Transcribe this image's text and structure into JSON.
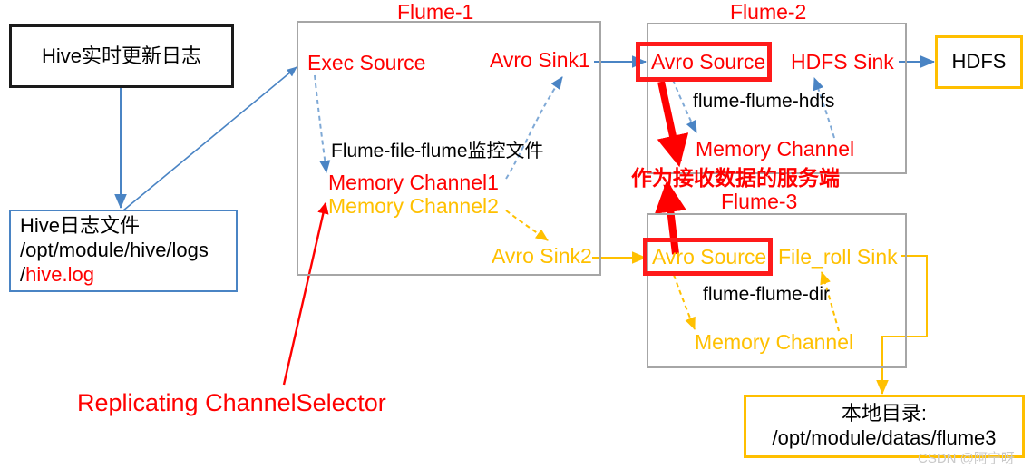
{
  "diagram": {
    "title": "Flume multi-agent replicating channel selector topology",
    "colors": {
      "red": "#ff0000",
      "yellow": "#ffc000",
      "blue": "#4a84c4",
      "black": "#000000",
      "frame_gray": "#a6a6a6"
    }
  },
  "source_box": {
    "label": "Hive实时更新日志"
  },
  "logfile_box": {
    "line1": "Hive日志文件",
    "line2": "/opt/module/hive/logs",
    "line3_prefix": "/",
    "line3_file": "hive.log"
  },
  "flume1": {
    "title": "Flume-1",
    "config_name": "Flume-file-flume监控文件",
    "source": "Exec Source",
    "sink1": "Avro Sink1",
    "sink2": "Avro Sink2",
    "channel1": "Memory  Channel1",
    "channel2": "Memory  Channel2"
  },
  "flume2": {
    "title": "Flume-2",
    "config_name": "flume-flume-hdfs",
    "source": "Avro Source",
    "sink": "HDFS Sink",
    "channel": "Memory Channel"
  },
  "flume3": {
    "title": "Flume-3",
    "config_name": "flume-flume-dir",
    "source": "Avro Source",
    "sink": "File_roll Sink",
    "channel": "Memory Channel"
  },
  "hdfs_box": {
    "label": "HDFS"
  },
  "localdir_box": {
    "line1": "本地目录:",
    "line2": "/opt/module/datas/flume3"
  },
  "annotations": {
    "server_note": "作为接收数据的服务端",
    "selector_note": "Replicating ChannelSelector"
  },
  "watermark": {
    "text": "CSDN @阿宁呀"
  }
}
